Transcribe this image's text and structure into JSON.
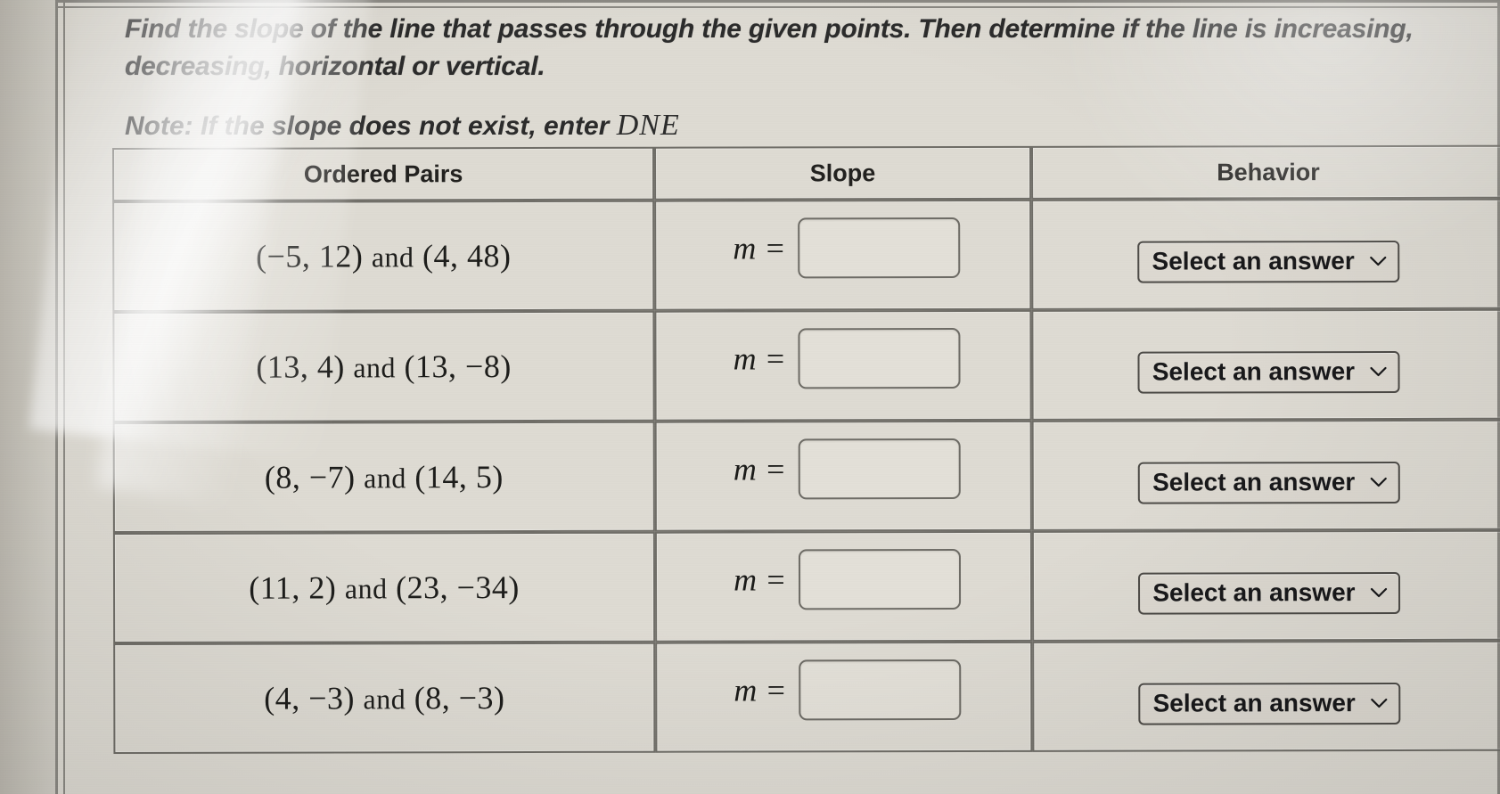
{
  "prompt": {
    "line1": "Find the slope of the line that passes through the given points. Then determine if the line is increasing,",
    "line2": "decreasing, horizontal or vertical.",
    "note_prefix": "Note: If the slope does not exist, enter ",
    "note_dne": "DNE"
  },
  "table": {
    "headers": {
      "pairs": "Ordered Pairs",
      "slope": "Slope",
      "behavior": "Behavior"
    },
    "slope_variable": "m =",
    "rows": [
      {
        "pairs": "(−5, 12)  and  (4, 48)",
        "point1": "(−5, 12)",
        "conjunction": "and",
        "point2": "(4, 48)",
        "slope_value": "",
        "slope_placeholder": "",
        "behavior_selected": "Select an answer"
      },
      {
        "pairs": "(13, 4)  and  (13, −8)",
        "point1": "(13, 4)",
        "conjunction": "and",
        "point2": "(13, −8)",
        "slope_value": "",
        "slope_placeholder": "",
        "behavior_selected": "Select an answer"
      },
      {
        "pairs": "(8, −7)  and  (14, 5)",
        "point1": "(8, −7)",
        "conjunction": "and",
        "point2": "(14, 5)",
        "slope_value": "",
        "slope_placeholder": "",
        "behavior_selected": "Select an answer"
      },
      {
        "pairs": "(11, 2)  and  (23, −34)",
        "point1": "(11, 2)",
        "conjunction": "and",
        "point2": "(23, −34)",
        "slope_value": "",
        "slope_placeholder": "",
        "behavior_selected": "Select an answer"
      },
      {
        "pairs": "(4, −3)  and  (8, −3)",
        "point1": "(4, −3)",
        "conjunction": "and",
        "point2": "(8, −3)",
        "slope_value": "",
        "slope_placeholder": "",
        "behavior_selected": "Select an answer"
      }
    ]
  },
  "icons": {
    "chevron_down": "chevron-down-icon"
  },
  "colors": {
    "page_background": "#dedbd3",
    "text": "#222222",
    "border": "#6f6d67",
    "input_fill": "#e3e0d8"
  }
}
